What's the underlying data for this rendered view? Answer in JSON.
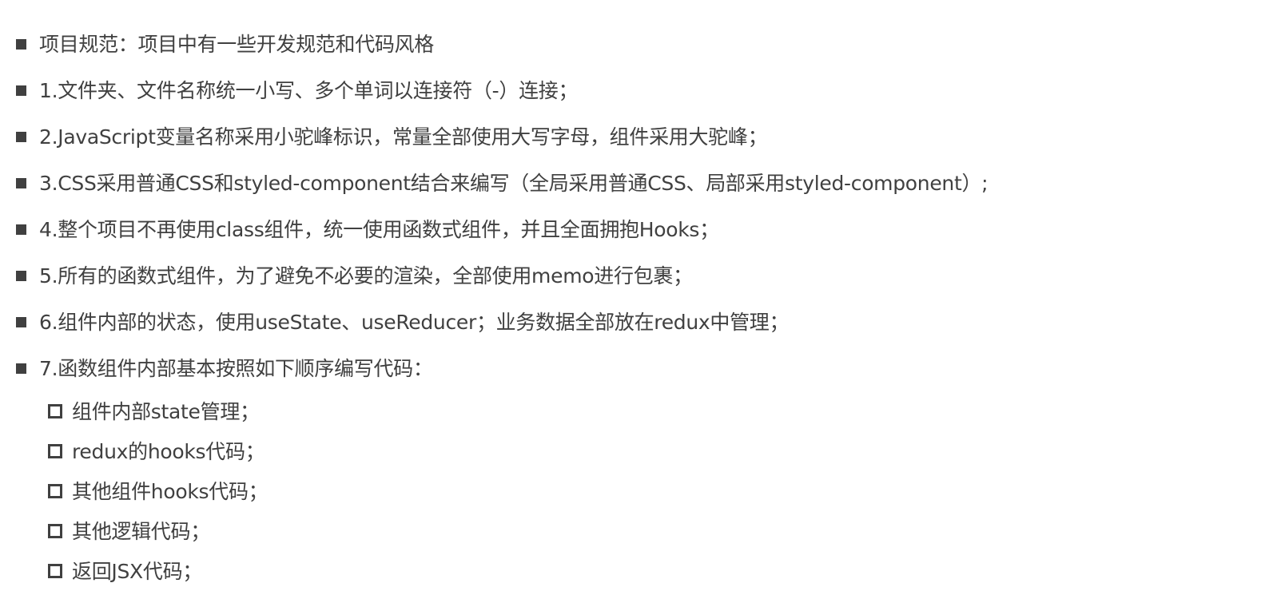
{
  "items": [
    {
      "text": "项目规范：项目中有一些开发规范和代码风格"
    },
    {
      "text": "1.文件夹、文件名称统一小写、多个单词以连接符（-）连接；"
    },
    {
      "text": "2.JavaScript变量名称采用小驼峰标识，常量全部使用大写字母，组件采用大驼峰；"
    },
    {
      "text": "3.CSS采用普通CSS和styled-component结合来编写（全局采用普通CSS、局部采用styled-component）;"
    },
    {
      "text": "4.整个项目不再使用class组件，统一使用函数式组件，并且全面拥抱Hooks；"
    },
    {
      "text": "5.所有的函数式组件，为了避免不必要的渲染，全部使用memo进行包裹；"
    },
    {
      "text": "6.组件内部的状态，使用useState、useReducer；业务数据全部放在redux中管理；"
    },
    {
      "text": "7.函数组件内部基本按照如下顺序编写代码："
    }
  ],
  "subitems": [
    {
      "text": "组件内部state管理；"
    },
    {
      "text": "redux的hooks代码；"
    },
    {
      "text": "其他组件hooks代码；"
    },
    {
      "text": "其他逻辑代码；"
    },
    {
      "text": "返回JSX代码；"
    }
  ]
}
